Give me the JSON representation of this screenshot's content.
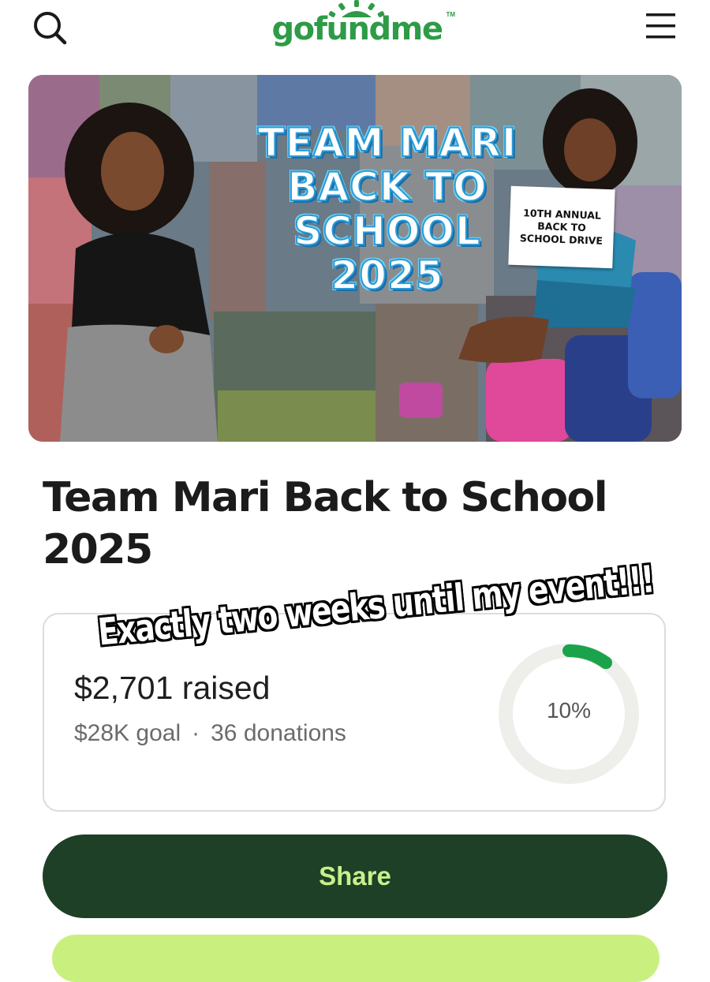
{
  "header": {
    "logo_text": "gofundme",
    "logo_tm": "TM",
    "search_icon": "search-icon",
    "menu_icon": "hamburger-menu-icon",
    "brand_color": "#2e9b47"
  },
  "hero": {
    "title_lines": [
      "TEAM MARI",
      "BACK TO",
      "SCHOOL",
      "2025"
    ],
    "sign_lines": [
      "10TH ANNUAL",
      "BACK TO",
      "SCHOOL DRIVE"
    ]
  },
  "campaign": {
    "title": "Team Mari Back to School 2025"
  },
  "overlay": {
    "caption": "Exactly two weeks until my event!!!"
  },
  "progress": {
    "raised": "$2,701 raised",
    "goal": "$28K goal",
    "separator": "·",
    "donations": "36 donations",
    "percent_label": "10%",
    "fraction": 0.1,
    "ring_color": "#1aa34a",
    "track_color": "#eeeeea"
  },
  "actions": {
    "share_label": "Share",
    "share_bg": "#1d4026",
    "share_text_color": "#c8f08a",
    "donate_bg": "#c9f07e"
  }
}
